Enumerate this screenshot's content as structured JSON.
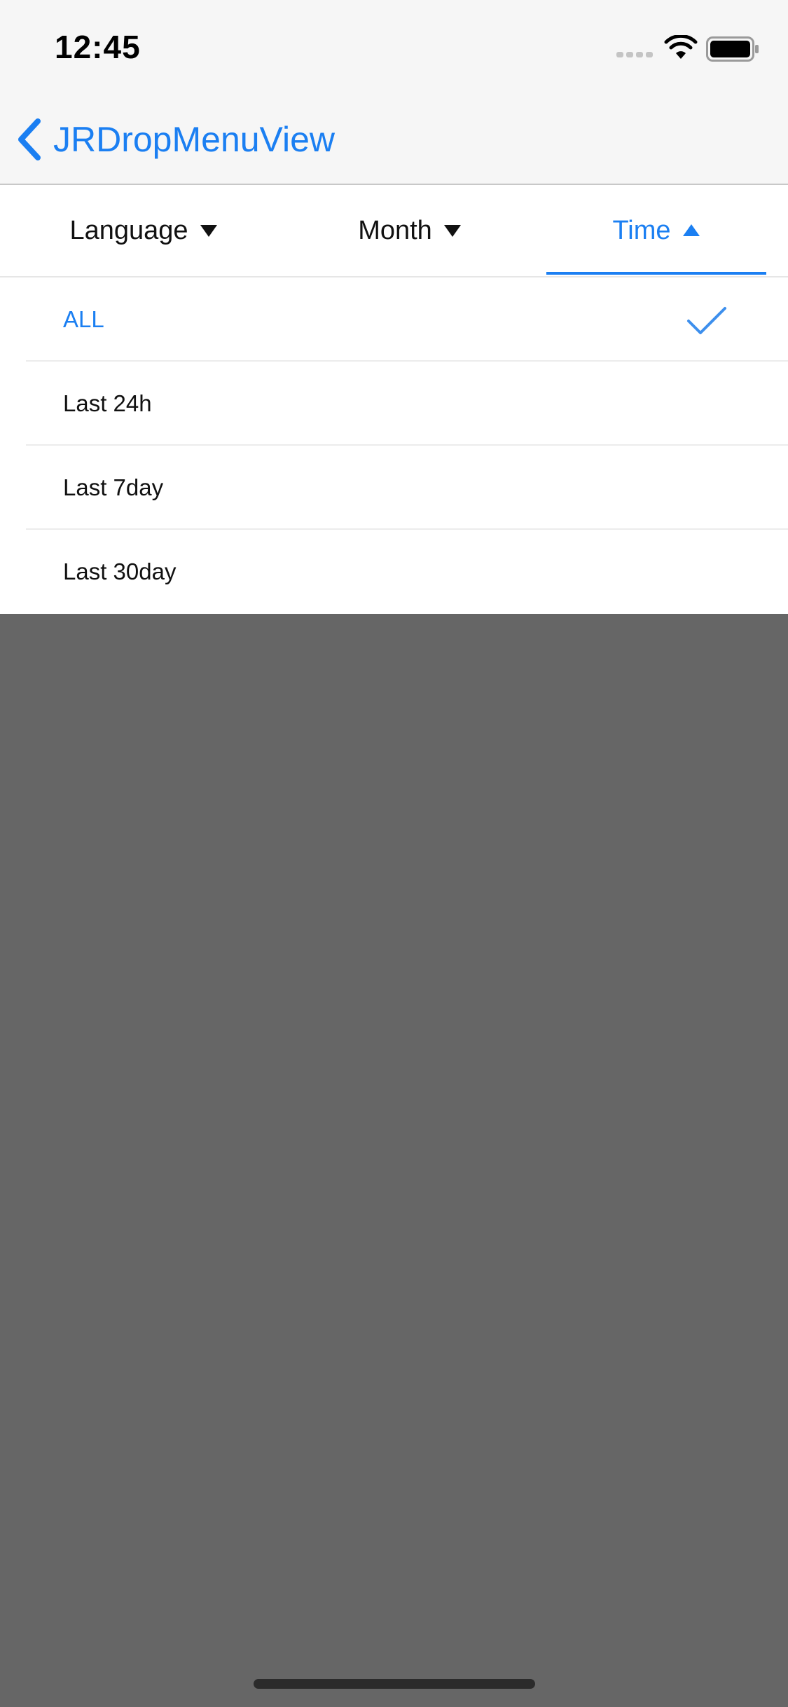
{
  "status_bar": {
    "time": "12:45",
    "icons": [
      "signal-icon",
      "wifi-icon",
      "battery-icon"
    ]
  },
  "nav": {
    "back_icon": "chevron-left-icon",
    "title": "JRDropMenuView"
  },
  "filters": {
    "tabs": [
      {
        "label": "Language",
        "icon": "caret-down-icon",
        "active": false
      },
      {
        "label": "Month",
        "icon": "caret-down-icon",
        "active": false
      },
      {
        "label": "Time",
        "icon": "caret-up-icon",
        "active": true
      }
    ]
  },
  "dropdown": {
    "items": [
      {
        "label": "ALL",
        "selected": true
      },
      {
        "label": "Last 24h",
        "selected": false
      },
      {
        "label": "Last 7day",
        "selected": false
      },
      {
        "label": "Last 30day",
        "selected": false
      }
    ],
    "selected_icon": "checkmark-icon"
  },
  "colors": {
    "accent": "#1b7ff2",
    "bar_background": "#f6f6f6",
    "overlay": "#666666",
    "text": "#111111"
  }
}
